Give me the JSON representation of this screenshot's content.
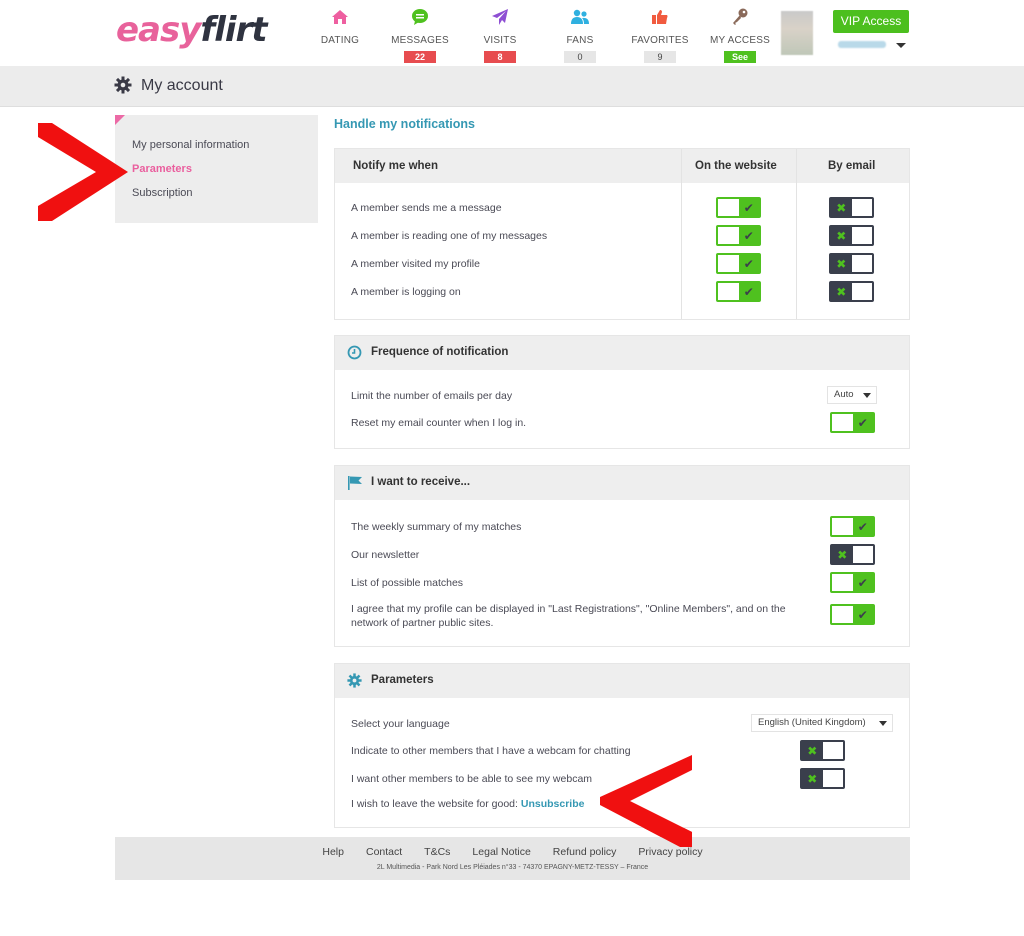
{
  "header": {
    "logo": {
      "part1": "easy",
      "part2": "flirt"
    },
    "nav": [
      {
        "label": "DATING",
        "icon": "home-icon",
        "color": "#ee5fa0",
        "badge": null
      },
      {
        "label": "MESSAGES",
        "icon": "chat-bubble-icon",
        "color": "#4fc11f",
        "badge": "22",
        "badge_style": "red"
      },
      {
        "label": "VISITS",
        "icon": "paper-plane-icon",
        "color": "#8e4fd3",
        "badge": "8",
        "badge_style": "red"
      },
      {
        "label": "FANS",
        "icon": "users-icon",
        "color": "#2fb0e0",
        "badge": "0",
        "badge_style": "grey"
      },
      {
        "label": "FAVORITES",
        "icon": "thumbs-up-icon",
        "color": "#f15b3f",
        "badge": "9",
        "badge_style": "grey"
      },
      {
        "label": "MY ACCESS",
        "icon": "key-icon",
        "color": "#8a6a5a",
        "badge": "See",
        "badge_style": "green"
      }
    ],
    "vip_button": "VIP Access"
  },
  "titlebar": {
    "title": "My account",
    "icon": "gear-icon"
  },
  "sidebar": {
    "items": [
      {
        "label": "My personal information",
        "active": false
      },
      {
        "label": "Parameters",
        "active": true
      },
      {
        "label": "Subscription",
        "active": false
      }
    ]
  },
  "notifications": {
    "section_title": "Handle my notifications",
    "headers": {
      "event": "Notify me when",
      "website": "On the website",
      "email": "By email"
    },
    "rows": [
      {
        "label": "A member sends me a message",
        "website": true,
        "email": false
      },
      {
        "label": "A member is reading one of my messages",
        "website": true,
        "email": false
      },
      {
        "label": "A member visited my profile",
        "website": true,
        "email": false
      },
      {
        "label": "A member is logging on",
        "website": true,
        "email": false
      }
    ]
  },
  "frequence": {
    "title": "Frequence of notification",
    "icon": "clock-icon",
    "limit_label": "Limit the number of emails per day",
    "limit_value": "Auto",
    "reset_label": "Reset my email counter when I log in.",
    "reset_on": true
  },
  "receive": {
    "title": "I want to receive...",
    "icon": "flag-icon",
    "rows": [
      {
        "label": "The weekly summary of my matches",
        "on": true
      },
      {
        "label": "Our newsletter",
        "on": false
      },
      {
        "label": "List of possible matches",
        "on": true
      },
      {
        "label": "I agree that my profile can be displayed in \"Last Registrations\", \"Online Members\", and on the network of partner public sites.",
        "on": true
      }
    ]
  },
  "parameters": {
    "title": "Parameters",
    "icon": "gear-icon",
    "language_label": "Select your language",
    "language_value": "English (United Kingdom)",
    "webcam_indicate_label": "Indicate to other members that I have a webcam for chatting",
    "webcam_indicate_on": false,
    "webcam_see_label": "I want other members to be able to see my webcam",
    "webcam_see_on": false,
    "leave_label": "I wish to leave the website for good:",
    "unsubscribe_link": "Unsubscribe"
  },
  "footer": {
    "links": [
      "Help",
      "Contact",
      "T&Cs",
      "Legal Notice",
      "Refund policy",
      "Privacy policy"
    ],
    "address": "2L Multimedia - Park Nord Les Pléiades n°33 - 74370 EPAGNY-METZ-TESSY – France"
  },
  "toggle_glyphs": {
    "on": "✔",
    "off": "✖"
  }
}
